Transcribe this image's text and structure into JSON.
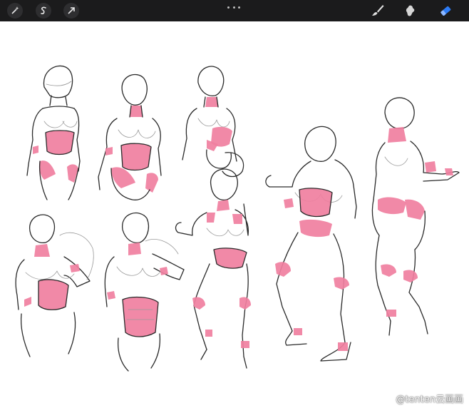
{
  "toolbar": {
    "left_tools": [
      {
        "icon": "magic-wand-icon"
      },
      {
        "icon": "selection-s-icon"
      },
      {
        "icon": "transform-arrow-icon"
      }
    ],
    "right_tools": [
      {
        "icon": "brush-icon"
      },
      {
        "icon": "smudge-icon"
      },
      {
        "icon": "eraser-icon",
        "active": true
      }
    ]
  },
  "canvas": {
    "accent_color": "#f07fa0",
    "line_color": "#2a2a2a"
  },
  "watermark": {
    "text": "@tenten云画画"
  }
}
